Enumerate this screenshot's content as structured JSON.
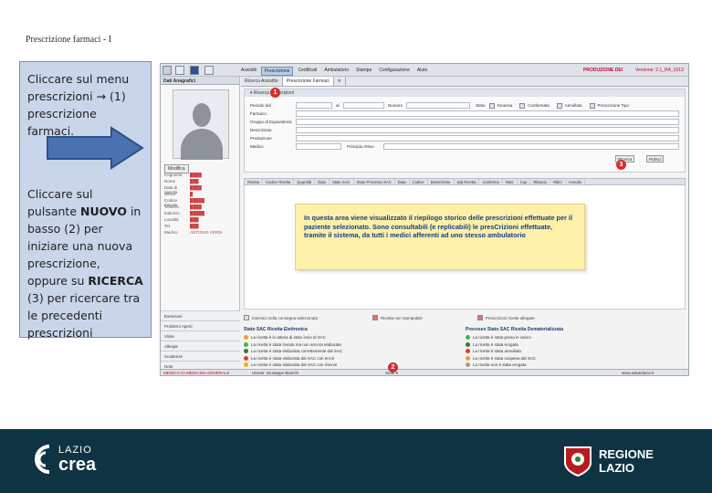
{
  "slide": {
    "title": "Prescrizione farmaci - I",
    "callout_p1": "Cliccare sul menu prescrizioni → (1) prescrizione farmaci.",
    "callout_p2_a": "Cliccare sul pulsante ",
    "callout_p2_nuovo": "NUOVO",
    "callout_p2_b": " in basso (2) per iniziare una nuova prescrizione, oppure su ",
    "callout_p2_ricerca": "RICERCA",
    "callout_p2_c": " (3) per ricercare tra le precedenti prescrizioni"
  },
  "app": {
    "menu": [
      "Assistiti",
      "Prescrizione",
      "Certificati",
      "Ambulatorio",
      "Stampe",
      "Configurazione",
      "Aiuto"
    ],
    "active_menu_index": 1,
    "environment": "PRODUZIONE DEI",
    "version": "Versione: 2.1_RA_0313",
    "left_panel": {
      "header": "Dati Anagrafici",
      "edit_button": "Modifica",
      "field_labels": [
        "Cognome",
        "Nome",
        "Data di nascita",
        "Sesso",
        "Codice Fiscale",
        "Tessera",
        "Indirizzo",
        "Località",
        "Tel.",
        "Medico"
      ],
      "medico_value": "ANTONIO VERDI",
      "list_items": [
        "Esenzioni",
        "Problemi Aperti",
        "Visite",
        "Allergie",
        "Scadenze",
        "Note"
      ]
    },
    "tabs": [
      "Ricerca Assistito",
      "Prescrizione Farmaci"
    ],
    "search_panel": {
      "header": "Ricerca Prescrizioni",
      "periodo_label": "Periodo dal",
      "al_label": "al",
      "numero_label": "Numero",
      "stato_label": "Stato",
      "stato_options": [
        "Emessa",
        "Confermata",
        "Annullata",
        "Prescrizione Tipo"
      ],
      "farmaco_label": "Farmaco",
      "gruppo_label": "Gruppo di Equivalenza",
      "descrizione_label": "Descrizione",
      "prestazione_label": "Prestazione",
      "medico_label": "Medico",
      "principio_label": "Principio Attivo",
      "search_button": "Ricerca",
      "clear_button": "Pulisci"
    },
    "grid_columns": [
      "Ricetta",
      "Codice Ricetta",
      "Quantità",
      "Data",
      "Stato SAC",
      "Stato Processo SAC",
      "Data",
      "Codice",
      "Descrizione",
      "Qtà Ricetta",
      "Conferma",
      "Note",
      "Cup",
      "Rilascio",
      "Ritiro",
      "Annulla"
    ],
    "note_text": "In questa area viene visualizzato il riepilogo storico delle prescrizioni effettuate per il paziente selezionato. Sono consultabili (e replicabili) le presCrizioni effettuate, tramite il sistema, da tutti i medici afferenti ad uno stesso ambulatorio",
    "actions": [
      "Inserisci nella consegna selezionata",
      "Ricetta non stampabile",
      "Prescrizioni ricette allegate"
    ],
    "legend_left": {
      "title": "Stato SAC Ricetta Elettronica",
      "items": [
        "La ricetta è in attesa di stato invio al SAC",
        "La ricetta è stata inviata ma non ancora elaborata",
        "La ricetta è stata elaborata correttamente dal SAC",
        "La ricetta è stata elaborata dal SAC con errori",
        "La ricetta è stata elaborata dal SAC con riserve"
      ]
    },
    "legend_right": {
      "title": "Processo Stato SAC Ricetta Dematerializzata",
      "items": [
        "La ricetta è stata presa in carico",
        "La ricetta è stata erogata",
        "La ricetta è stata annullata",
        "La ricetta è stata sospesa dal SAC",
        "La ricetta non è stata erogata"
      ]
    },
    "bottom": {
      "user": "MEDICO DI MEDICINA GENERALE",
      "operator_label": "Utente:",
      "operator_value": "Giuseppe Bianchi",
      "sede_label": "Sede",
      "site": "www.salutelazio.it"
    }
  },
  "badges": [
    "1",
    "2",
    "3"
  ],
  "footer": {
    "lazio": "LAZIO",
    "crea": "crea",
    "regione": "REGIONE",
    "regione2": "LAZIO"
  },
  "colors": {
    "footer_bg": "#0e3443",
    "callout_bg": "#c9d6ea",
    "arrow": "#4a72b3",
    "note_bg": "#fdf0a8",
    "note_text": "#1a3a8a",
    "badge": "#d32f2f"
  }
}
